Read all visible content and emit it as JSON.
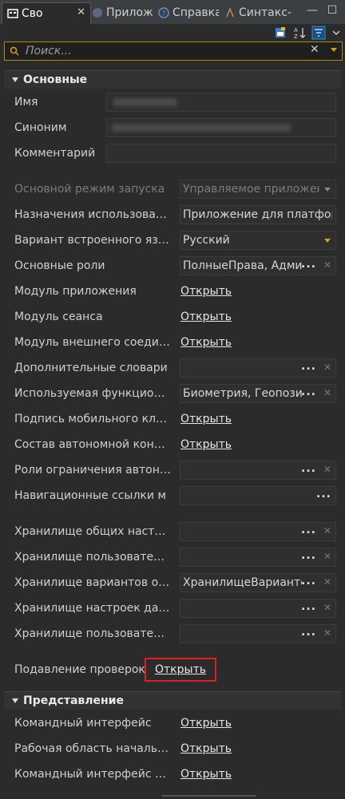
{
  "tabs": [
    {
      "label": "Сво",
      "icon": "properties-icon",
      "active": true
    },
    {
      "label": "Прилож",
      "icon": "app-icon"
    },
    {
      "label": "Справка",
      "icon": "help-icon"
    },
    {
      "label": "Синтакс-",
      "icon": "syntax-icon"
    }
  ],
  "search": {
    "placeholder": "Поиск..."
  },
  "sections": {
    "main": "Основные",
    "view": "Представление"
  },
  "fields": {
    "name": "Имя",
    "synonym": "Синоним",
    "comment": "Комментарий",
    "launch_mode": "Основной режим запуска",
    "launch_mode_value": "Управляемое приложение",
    "purposes": "Назначения использования",
    "purposes_value": "Приложение для платформы",
    "script_variant": "Вариант встроенного языка",
    "script_variant_value": "Русский",
    "default_roles": "Основные роли",
    "default_roles_value": "ПолныеПрава, Администратор",
    "app_module": "Модуль приложения",
    "session_module": "Модуль сеанса",
    "ext_conn_module": "Модуль внешнего соединения",
    "extra_dicts": "Дополнительные словари",
    "used_func": "Используемая функциональность",
    "used_func_value": "Биометрия, Геопозиционирование",
    "mobile_sign": "Подпись мобильного клиента",
    "standalone_comp": "Состав автономной конфигурации",
    "standalone_roles": "Роли ограничения автономной",
    "nav_links": "Навигационные ссылки м",
    "common_settings": "Хранилище общих настроек",
    "user_settings": "Хранилище пользовательских",
    "report_variants": "Хранилище вариантов отчетов",
    "report_variants_value": "ХранилищеВариантовОтчетов",
    "data_settings": "Хранилище настроек данных",
    "user_filters": "Хранилище пользовательских",
    "check_suppress": "Подавление проверок",
    "cmd_interface": "Командный интерфейс",
    "home_area": "Рабочая область начальной",
    "cmd_interface_main": "Командный интерфейс основного"
  },
  "actions": {
    "open": "Открыть",
    "dots": "..."
  },
  "colors": {
    "accent": "#d6a400",
    "highlight": "#e02020",
    "background": "#2b2b2b"
  }
}
